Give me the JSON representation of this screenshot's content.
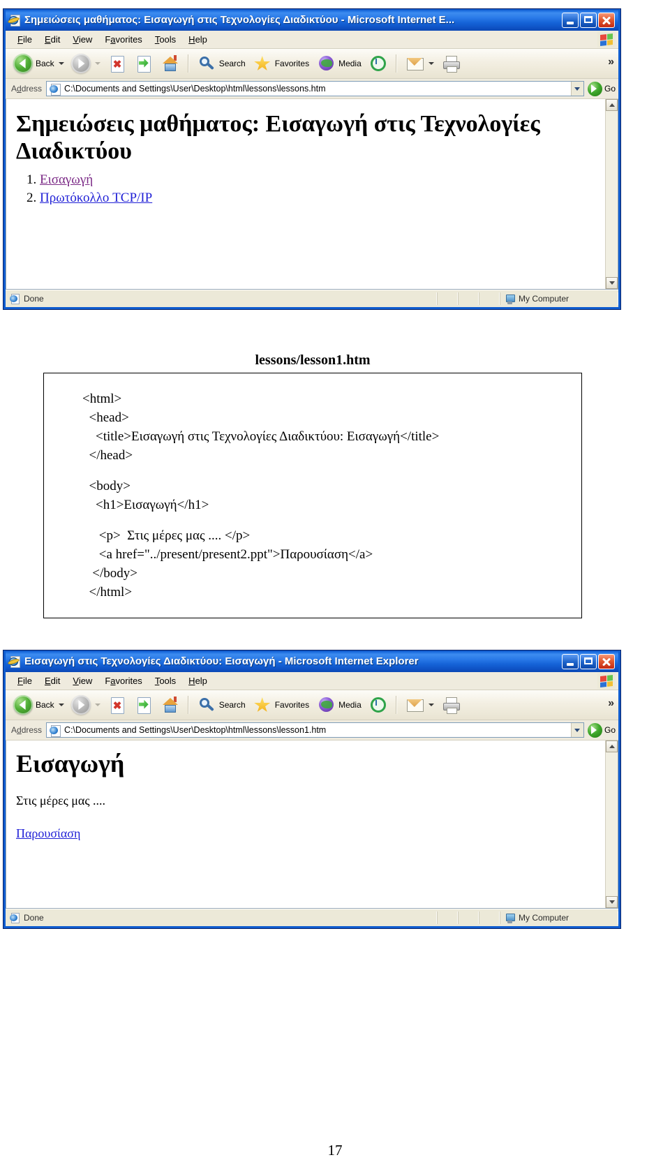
{
  "window1": {
    "title": "Σημειώσεις μαθήματος: Εισαγωγή στις Τεχνολογίες Διαδικτύου - Microsoft Internet E...",
    "menu": [
      "File",
      "Edit",
      "View",
      "Favorites",
      "Tools",
      "Help"
    ],
    "toolbar": {
      "back_label": "Back",
      "search_label": "Search",
      "favorites_label": "Favorites",
      "media_label": "Media",
      "overflow_label": "»"
    },
    "address": {
      "label": "Address",
      "value": "C:\\Documents and Settings\\User\\Desktop\\html\\lessons\\lessons.htm",
      "go_label": "Go"
    },
    "page": {
      "heading": "Σημειώσεις μαθήματος: Εισαγωγή στις Τεχνολογίες Διαδικτύου",
      "links": [
        {
          "text": "Εισαγωγή",
          "state": "visited"
        },
        {
          "text": "Πρωτόκολλο TCP/IP",
          "state": "normal"
        }
      ]
    },
    "status": {
      "text": "Done",
      "zone": "My Computer"
    }
  },
  "code_listing": {
    "caption": "lessons/lesson1.htm",
    "lines": [
      "<html>",
      "  <head>",
      "    <title>Εισαγωγή στις Τεχνολογίες Διαδικτύου: Εισαγωγή</title>",
      "  </head>",
      "",
      "  <body>",
      "    <h1>Εισαγωγή</h1>",
      "",
      "     <p>  Στις μέρες μας .... </p>",
      "     <a href=\"../present/present2.ppt\">Παρουσίαση</a>",
      "   </body>",
      "  </html>"
    ]
  },
  "window2": {
    "title": "Εισαγωγή στις Τεχνολογίες Διαδικτύου: Εισαγωγή - Microsoft Internet Explorer",
    "menu": [
      "File",
      "Edit",
      "View",
      "Favorites",
      "Tools",
      "Help"
    ],
    "toolbar": {
      "back_label": "Back",
      "search_label": "Search",
      "favorites_label": "Favorites",
      "media_label": "Media",
      "overflow_label": "»"
    },
    "address": {
      "label": "Address",
      "value": "C:\\Documents and Settings\\User\\Desktop\\html\\lessons\\lesson1.htm",
      "go_label": "Go"
    },
    "page": {
      "heading": "Εισαγωγή",
      "paragraph": "Στις μέρες μας ....",
      "link": "Παρουσίαση"
    },
    "status": {
      "text": "Done",
      "zone": "My Computer"
    }
  },
  "footer": {
    "page_number": "17"
  }
}
